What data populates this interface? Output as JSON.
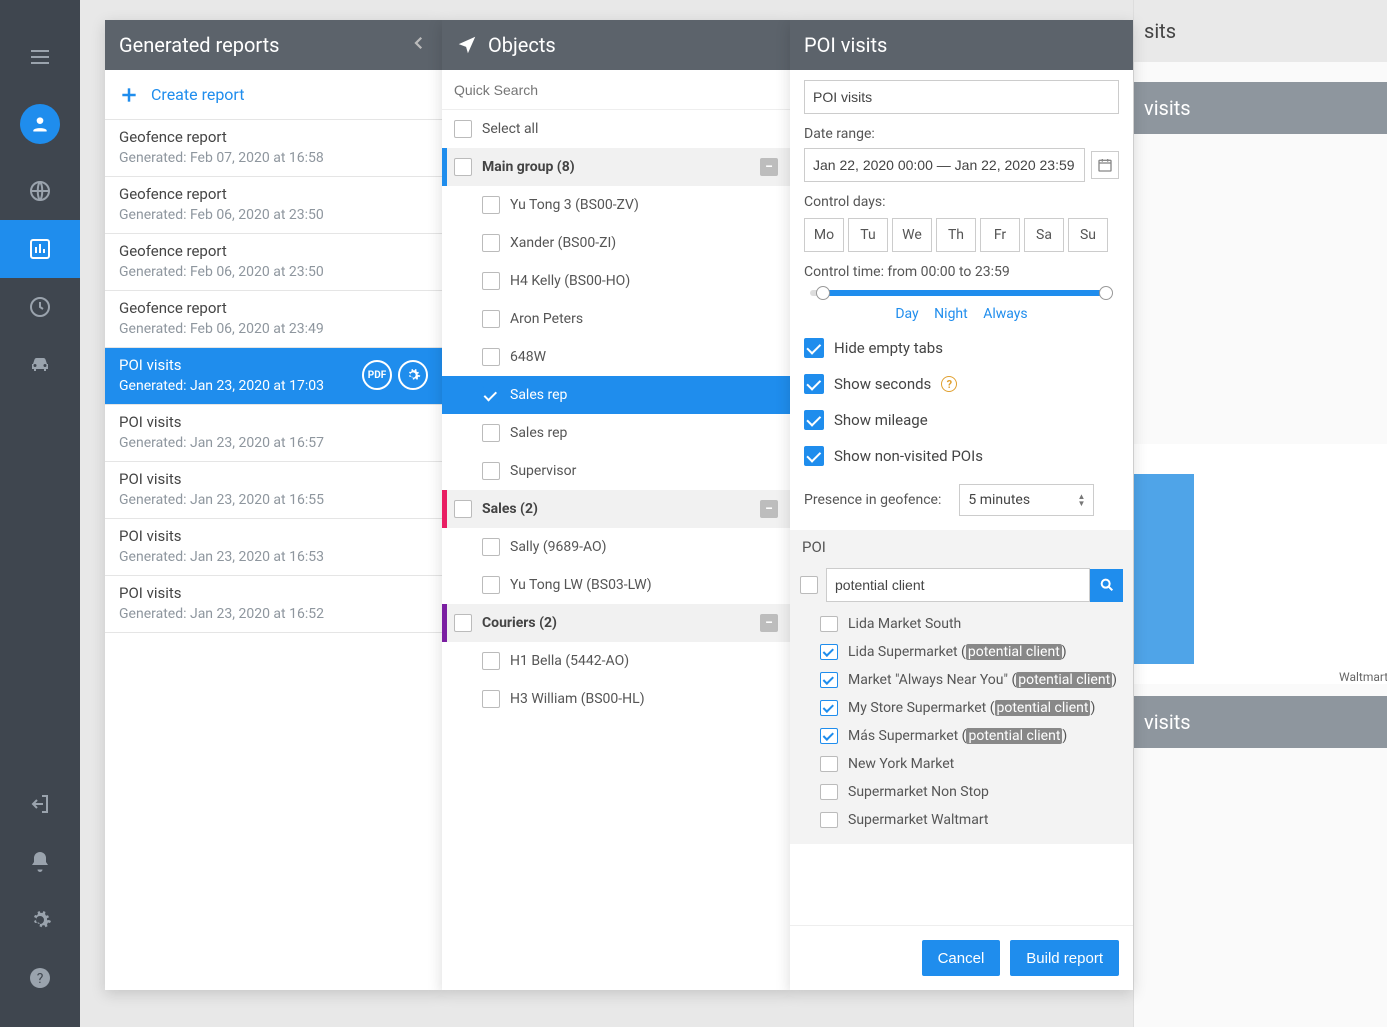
{
  "rail": {},
  "bg": {
    "header": "sits",
    "sec1": "visits",
    "bar_label": "Waltmart",
    "sec2": "visits"
  },
  "reportsPanel": {
    "title": "Generated reports",
    "create": "Create report",
    "items": [
      {
        "title": "Geofence report",
        "sub": "Generated: Feb 07, 2020 at 16:58"
      },
      {
        "title": "Geofence report",
        "sub": "Generated: Feb 06, 2020 at 23:50"
      },
      {
        "title": "Geofence report",
        "sub": "Generated: Feb 06, 2020 at 23:50"
      },
      {
        "title": "Geofence report",
        "sub": "Generated: Feb 06, 2020 at 23:49"
      },
      {
        "title": "POI visits",
        "sub": "Generated: Jan 23, 2020 at 17:03",
        "selected": true,
        "pdf": true,
        "gear": true
      },
      {
        "title": "POI visits",
        "sub": "Generated: Jan 23, 2020 at 16:57"
      },
      {
        "title": "POI visits",
        "sub": "Generated: Jan 23, 2020 at 16:55"
      },
      {
        "title": "POI visits",
        "sub": "Generated: Jan 23, 2020 at 16:53"
      },
      {
        "title": "POI visits",
        "sub": "Generated: Jan 23, 2020 at 16:52"
      }
    ]
  },
  "objectsPanel": {
    "title": "Objects",
    "search_placeholder": "Quick Search",
    "select_all": "Select all",
    "groups": {
      "main": {
        "label": "Main group (8)",
        "stripe": "#1f8ded",
        "items": [
          "Yu Tong 3 (BS00-ZV)",
          "Xander (BS00-ZI)",
          "H4 Kelly (BS00-HO)",
          "Aron Peters",
          "648W"
        ],
        "selected_item": "Sales rep",
        "after": [
          "Sales rep",
          "Supervisor"
        ]
      },
      "sales": {
        "label": "Sales (2)",
        "stripe": "#e91e63",
        "items": [
          "Sally (9689-AO)",
          "Yu Tong LW (BS03-LW)"
        ]
      },
      "couriers": {
        "label": "Couriers (2)",
        "stripe": "#7b1fa2",
        "items": [
          "H1 Bella (5442-AO)",
          "H3 William (BS00-HL)"
        ]
      }
    }
  },
  "settings": {
    "title": "POI visits",
    "name_value": "POI visits",
    "date_label": "Date range:",
    "date_value": "Jan 22, 2020 00:00 — Jan 22, 2020 23:59",
    "control_days_label": "Control days:",
    "days": [
      "Mo",
      "Tu",
      "We",
      "Th",
      "Fr",
      "Sa",
      "Su"
    ],
    "control_time_label": "Control time: from 00:00 to 23:59",
    "links": {
      "day": "Day",
      "night": "Night",
      "always": "Always"
    },
    "opt_hide": "Hide empty tabs",
    "opt_secs": "Show seconds",
    "opt_mileage": "Show mileage",
    "opt_nonvisited": "Show non-visited POIs",
    "presence_label": "Presence in geofence:",
    "presence_value": "5  minutes",
    "poi_heading": "POI",
    "poi_search_value": "potential client",
    "poi_items": [
      {
        "label": "Lida Market South",
        "on": false,
        "hl": null
      },
      {
        "label": "Lida Supermarket",
        "on": true,
        "hl": "potential client"
      },
      {
        "label": "Market \"Always Near You\"",
        "on": true,
        "hl": "potential client"
      },
      {
        "label": "My Store Supermarket",
        "on": true,
        "hl": "potential client"
      },
      {
        "label": "Más Supermarket",
        "on": true,
        "hl": "potential client"
      },
      {
        "label": "New York Market",
        "on": false,
        "hl": null
      },
      {
        "label": "Supermarket Non Stop",
        "on": false,
        "hl": null
      },
      {
        "label": "Supermarket Waltmart",
        "on": false,
        "hl": null
      }
    ],
    "cancel": "Cancel",
    "build": "Build report"
  }
}
